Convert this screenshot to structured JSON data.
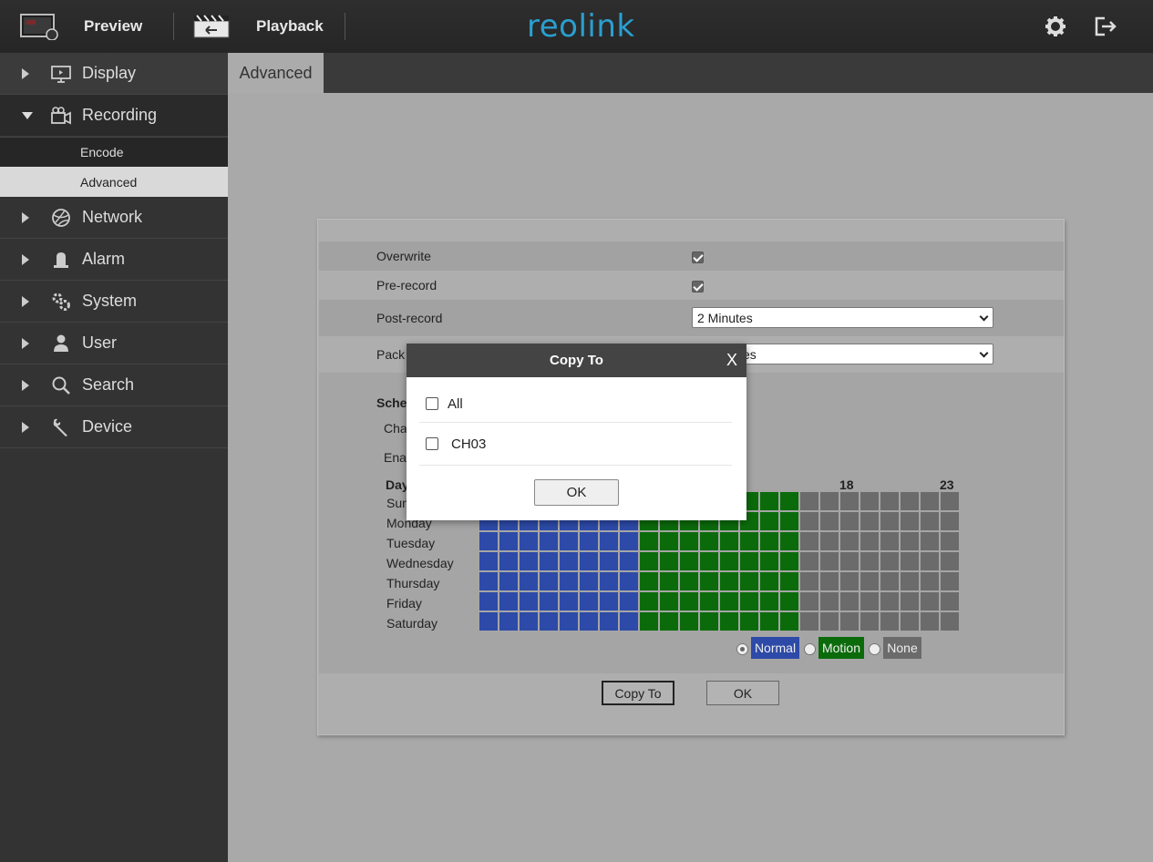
{
  "topbar": {
    "preview_label": "Preview",
    "playback_label": "Playback",
    "logo_text": "reolink",
    "settings_icon": "gear-icon",
    "logout_icon": "logout-icon"
  },
  "sidebar": {
    "items": [
      {
        "label": "Display",
        "icon": "monitor-icon"
      },
      {
        "label": "Recording",
        "icon": "camera-icon"
      },
      {
        "label": "Network",
        "icon": "globe-icon"
      },
      {
        "label": "Alarm",
        "icon": "alarm-icon"
      },
      {
        "label": "System",
        "icon": "gears-icon"
      },
      {
        "label": "User",
        "icon": "user-icon"
      },
      {
        "label": "Search",
        "icon": "search-icon"
      },
      {
        "label": "Device",
        "icon": "wrench-icon"
      }
    ],
    "recording_sub": [
      "Encode",
      "Advanced"
    ]
  },
  "tabs": {
    "active": "Advanced"
  },
  "settings": {
    "overwrite_label": "Overwrite",
    "overwrite_checked": true,
    "prerecord_label": "Pre-record",
    "prerecord_checked": true,
    "postrecord_label": "Post-record",
    "postrecord_value": "2 Minutes",
    "pack_label": "Pack",
    "pack_value_partial": "es"
  },
  "schedule": {
    "title_partial": "Sche",
    "channel_partial": "Cha",
    "enable_partial": "Ena",
    "day_header": "Day",
    "hour_labels": [
      "18",
      "23"
    ],
    "days": [
      "Sunday",
      "Monday",
      "Tuesday",
      "Wednesday",
      "Thursday",
      "Friday",
      "Saturday"
    ],
    "day_partial_sunday": "Sun",
    "colors": {
      "normal": "#2d4aa8",
      "motion": "#0b6b0b",
      "none": "#6b6b6b"
    },
    "hour_modes": [
      "normal",
      "normal",
      "normal",
      "normal",
      "normal",
      "normal",
      "normal",
      "normal",
      "motion",
      "motion",
      "motion",
      "motion",
      "motion",
      "motion",
      "motion",
      "motion",
      "none",
      "none",
      "none",
      "none",
      "none",
      "none",
      "none",
      "none"
    ],
    "legend": {
      "normal": "Normal",
      "motion": "Motion",
      "none": "None",
      "selected": "normal"
    }
  },
  "buttons": {
    "copy_to": "Copy To",
    "ok": "OK"
  },
  "modal": {
    "title": "Copy To",
    "close": "X",
    "options": [
      {
        "label": "All",
        "checked": false
      },
      {
        "label": "CH03",
        "checked": false
      }
    ],
    "ok": "OK"
  }
}
